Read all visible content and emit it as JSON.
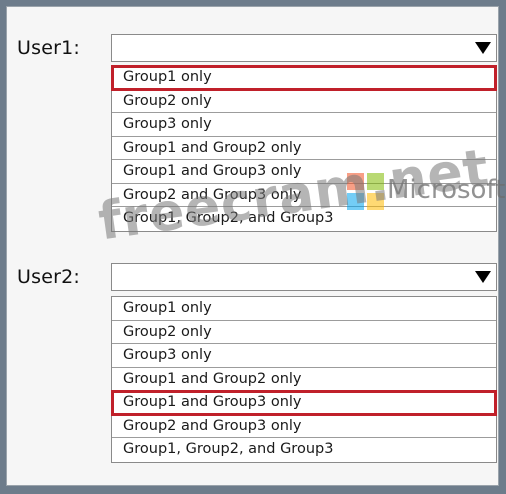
{
  "user1": {
    "label": "User1:",
    "selected_value": "",
    "options": [
      "Group1 only",
      "Group2 only",
      "Group3 only",
      "Group1 and Group2 only",
      "Group1 and Group3 only",
      "Group2 and Group3 only",
      "Group1, Group2, and Group3"
    ],
    "highlighted_index": 0
  },
  "user2": {
    "label": "User2:",
    "selected_value": "",
    "options": [
      "Group1 only",
      "Group2 only",
      "Group3 only",
      "Group1 and Group2 only",
      "Group1 and Group3 only",
      "Group2 and Group3 only",
      "Group1, Group2, and Group3"
    ],
    "highlighted_index": 4
  },
  "watermark": {
    "text": "freecram.net",
    "brand": "Microsoft",
    "logo_colors": [
      "#f25022",
      "#7fba00",
      "#00a4ef",
      "#ffb900"
    ]
  },
  "colors": {
    "highlight": "#c0202a",
    "frame": "#6d7c8b"
  }
}
